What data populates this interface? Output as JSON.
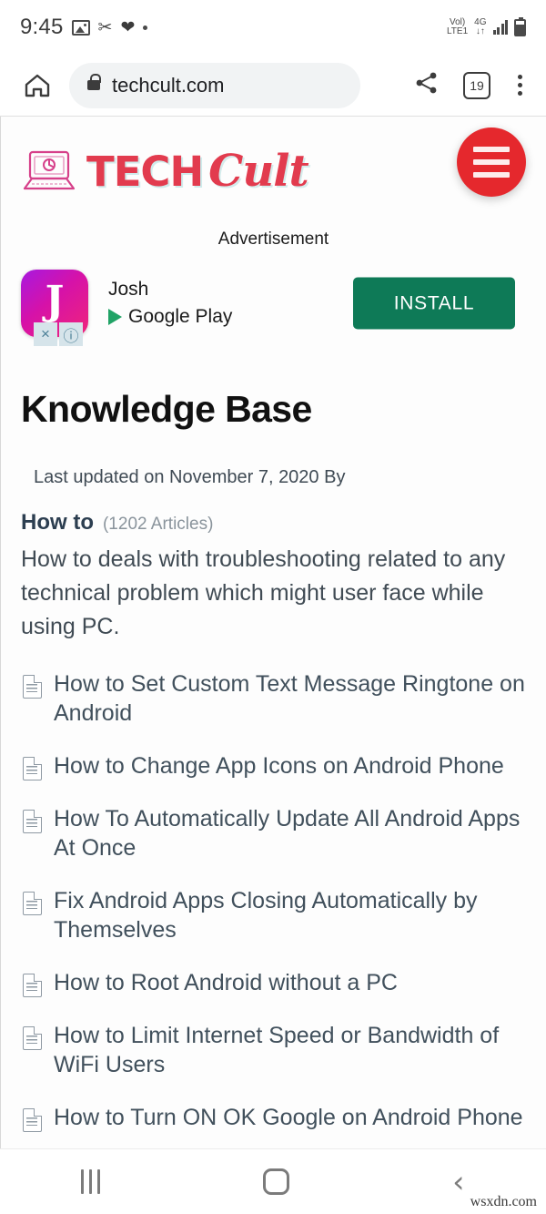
{
  "status_bar": {
    "time": "9:45",
    "left_icons": [
      "image-icon",
      "scissors-icon",
      "heart-check-icon",
      "dot-icon"
    ],
    "volte_line1": "Vol)",
    "volte_line2": "LTE1",
    "network": "4G",
    "network_arrows": "↓↑",
    "signal_icon": "signal-bars-icon",
    "battery_icon": "battery-icon"
  },
  "browser": {
    "home_icon": "home-icon",
    "lock_icon": "lock-icon",
    "url": "techcult.com",
    "share_icon": "share-icon",
    "tab_count": "19",
    "menu_icon": "kebab-menu-icon"
  },
  "site": {
    "logo_mark": "laptop-icon",
    "logo_word1": "TECH",
    "logo_word2": "Cult",
    "logo_color": "#e23b4e",
    "menu_button_icon": "hamburger-icon",
    "menu_button_color": "#e5282d"
  },
  "advertisement": {
    "label": "Advertisement",
    "app_icon_letter": "J",
    "app_name": "Josh",
    "store": "Google Play",
    "store_icon": "google-play-icon",
    "install_label": "INSTALL",
    "install_color": "#0e7a57",
    "close_icon": "×",
    "info_icon": "ⓘ"
  },
  "article": {
    "title": "Knowledge Base",
    "meta": "Last updated on November 7, 2020 By",
    "category": "How to",
    "article_count": "(1202 Articles)",
    "description": "How to deals with troubleshooting related to any technical problem which might user face while using PC.",
    "links": [
      "How to Set Custom Text Message Ringtone on Android",
      "How to Change App Icons on Android Phone",
      "How To Automatically Update All Android Apps At Once",
      "Fix Android Apps Closing Automatically by Themselves",
      "How to Root Android without a PC",
      "How to Limit Internet Speed or Bandwidth of WiFi Users",
      "How to Turn ON OK Google on Android Phone"
    ]
  },
  "navigation": {
    "recents_icon": "recents-icon",
    "home_icon": "home-square-icon",
    "back_icon": "‹",
    "watermark": "wsxdn.com"
  }
}
